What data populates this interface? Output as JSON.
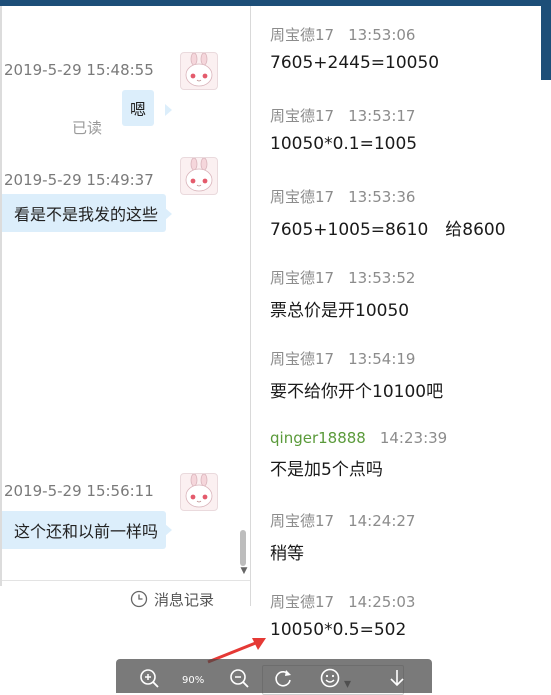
{
  "left_chat": {
    "groups": [
      {
        "timestamp": "2019-5-29 15:48:55",
        "bubble": "嗯",
        "status": "已读"
      },
      {
        "timestamp": "2019-5-29 15:49:37",
        "bubble": "看是不是我发的这些"
      },
      {
        "timestamp": "2019-5-29 15:56:11",
        "bubble": "这个还和以前一样吗"
      }
    ],
    "history_button": "消息记录"
  },
  "messages": [
    {
      "sender": "周宝德17",
      "time": "13:53:06",
      "text": "7605+2445=10050"
    },
    {
      "sender": "周宝德17",
      "time": "13:53:17",
      "text": "10050*0.1=1005"
    },
    {
      "sender": "周宝德17",
      "time": "13:53:36",
      "text": "7605+1005=8610　给8600"
    },
    {
      "sender": "周宝德17",
      "time": "13:53:52",
      "text": "票总价是开10050"
    },
    {
      "sender": "周宝德17",
      "time": "13:54:19",
      "text": "要不给你开个10100吧"
    },
    {
      "sender": "qinger18888",
      "time": "14:23:39",
      "text": "不是加5个点吗"
    },
    {
      "sender": "周宝德17",
      "time": "14:24:27",
      "text": "稍等"
    },
    {
      "sender": "周宝德17",
      "time": "14:25:03",
      "text": "10050*0.5=502"
    }
  ],
  "toolbar": {
    "zoom_level": "90%",
    "icons": [
      "zoom-in-icon",
      "zoom-out-icon",
      "rotate-icon",
      "emoji-icon",
      "download-icon"
    ]
  },
  "colors": {
    "bubble": "#dceefb",
    "peer_name": "#5a9a3a",
    "annotation_arrow": "#e53935"
  }
}
